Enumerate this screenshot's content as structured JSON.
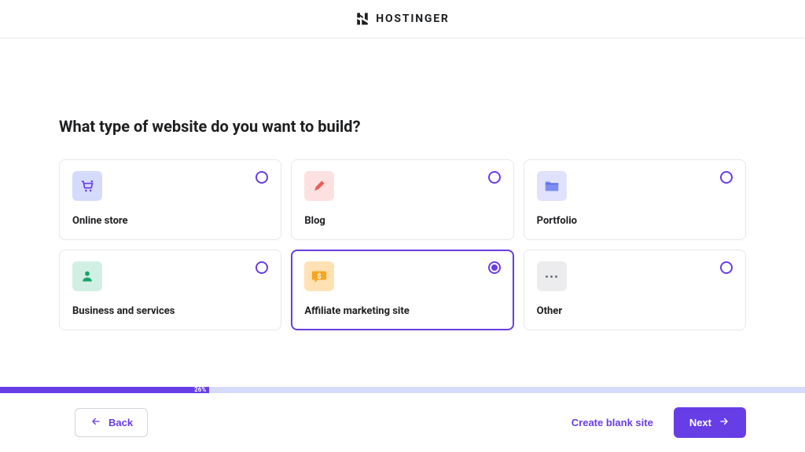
{
  "brand": {
    "name": "HOSTINGER"
  },
  "question": "What type of website do you want to build?",
  "options": [
    {
      "label": "Online store"
    },
    {
      "label": "Blog"
    },
    {
      "label": "Portfolio"
    },
    {
      "label": "Business and services"
    },
    {
      "label": "Affiliate marketing site"
    },
    {
      "label": "Other"
    }
  ],
  "selected_index": 4,
  "progress": {
    "percent": 26,
    "label": "26%"
  },
  "footer": {
    "back": "Back",
    "blank": "Create blank site",
    "next": "Next"
  }
}
